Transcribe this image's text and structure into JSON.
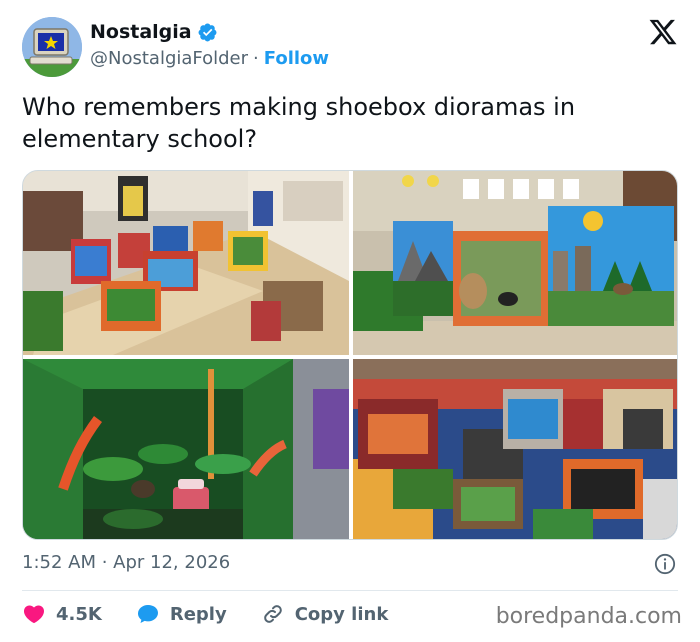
{
  "author": {
    "name": "Nostalgia",
    "handle": "@NostalgiaFolder",
    "separator": "·",
    "follow_label": "Follow",
    "verified": true,
    "accent_color": "#1d9bf0"
  },
  "tweet": {
    "text": "Who remembers making shoebox dioramas in elementary school?",
    "timestamp": "1:52 AM · Apr 12, 2026",
    "photos": [
      "classroom-dioramas-photo",
      "three-dioramas-photo",
      "jungle-diorama-photo",
      "floor-dioramas-photo"
    ]
  },
  "actions": {
    "likes": "4.5K",
    "reply_label": "Reply",
    "copy_label": "Copy link",
    "like_color": "#f91880"
  },
  "icons": [
    "verified-badge-icon",
    "x-logo-icon",
    "info-icon",
    "heart-icon",
    "reply-bubble-icon",
    "link-icon"
  ],
  "watermark": "boredpanda.com"
}
